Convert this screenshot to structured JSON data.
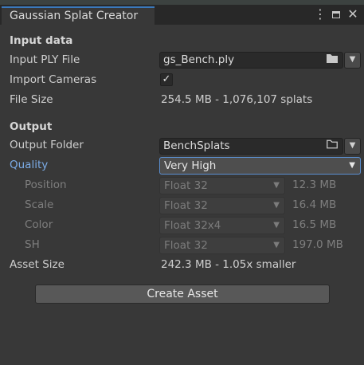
{
  "window": {
    "title": "Gaussian Splat Creator"
  },
  "input": {
    "section": "Input data",
    "ply_label": "Input PLY File",
    "ply_value": "gs_Bench.ply",
    "import_cameras_label": "Import Cameras",
    "import_cameras_checked": true,
    "file_size_label": "File Size",
    "file_size_value": "254.5 MB - 1,076,107 splats"
  },
  "output": {
    "section": "Output",
    "folder_label": "Output Folder",
    "folder_value": "BenchSplats",
    "quality_label": "Quality",
    "quality_value": "Very High",
    "rows": [
      {
        "label": "Position",
        "format": "Float 32",
        "size": "12.3 MB"
      },
      {
        "label": "Scale",
        "format": "Float 32",
        "size": "16.4 MB"
      },
      {
        "label": "Color",
        "format": "Float 32x4",
        "size": "16.5 MB"
      },
      {
        "label": "SH",
        "format": "Float 32",
        "size": "197.0 MB"
      }
    ],
    "asset_size_label": "Asset Size",
    "asset_size_value": "242.3 MB - 1.05x smaller",
    "create_button": "Create Asset"
  },
  "icons": {
    "kebab": "⋮",
    "check": "✓",
    "arrow": "▼",
    "folder_filled": "folder-filled-icon",
    "folder_outline": "folder-outline-icon"
  },
  "colors": {
    "accent": "#3a79bb",
    "quality_label": "#7babe6"
  }
}
